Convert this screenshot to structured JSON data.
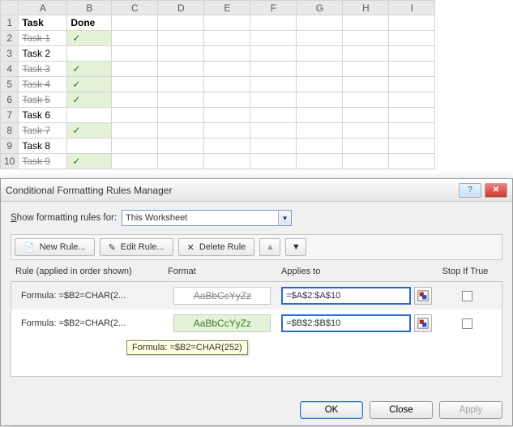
{
  "sheet": {
    "columns": [
      "A",
      "B",
      "C",
      "D",
      "E",
      "F",
      "G",
      "H",
      "I"
    ],
    "rows": [
      {
        "n": 1,
        "a": "Task",
        "b": "Done",
        "boldRow": true
      },
      {
        "n": 2,
        "a": "Task 1",
        "b": "✓",
        "strike": true,
        "check": true
      },
      {
        "n": 3,
        "a": "Task 2",
        "b": ""
      },
      {
        "n": 4,
        "a": "Task 3",
        "b": "✓",
        "strike": true,
        "check": true
      },
      {
        "n": 5,
        "a": "Task 4",
        "b": "✓",
        "strike": true,
        "check": true
      },
      {
        "n": 6,
        "a": "Task 5",
        "b": "✓",
        "strike": true,
        "check": true
      },
      {
        "n": 7,
        "a": "Task 6",
        "b": ""
      },
      {
        "n": 8,
        "a": "Task 7",
        "b": "✓",
        "strike": true,
        "check": true
      },
      {
        "n": 9,
        "a": "Task 8",
        "b": ""
      },
      {
        "n": 10,
        "a": "Task 9",
        "b": "✓",
        "strike": true,
        "check": true
      }
    ]
  },
  "dialog": {
    "title": "Conditional Formatting Rules Manager",
    "show_label_pre": "S",
    "show_label_mid": "how formatting rules for:",
    "scope_value": "This Worksheet",
    "buttons": {
      "new": "New Rule...",
      "edit": "Edit Rule...",
      "delete": "Delete Rule"
    },
    "headers": {
      "rule": "Rule (applied in order shown)",
      "format": "Format",
      "applies": "Applies to",
      "stop": "Stop If True"
    },
    "rules": [
      {
        "formula": "Formula: =$B2=CHAR(2...",
        "preview": "AaBbCcYyZz",
        "applies": "=$A$2:$A$10",
        "style": "a"
      },
      {
        "formula": "Formula: =$B2=CHAR(2...",
        "preview": "AaBbCcYyZz",
        "applies": "=$B$2:$B$10",
        "style": "b"
      }
    ],
    "tooltip": "Formula: =$B2=CHAR(252)",
    "footer": {
      "ok": "OK",
      "close": "Close",
      "apply": "Apply"
    }
  }
}
